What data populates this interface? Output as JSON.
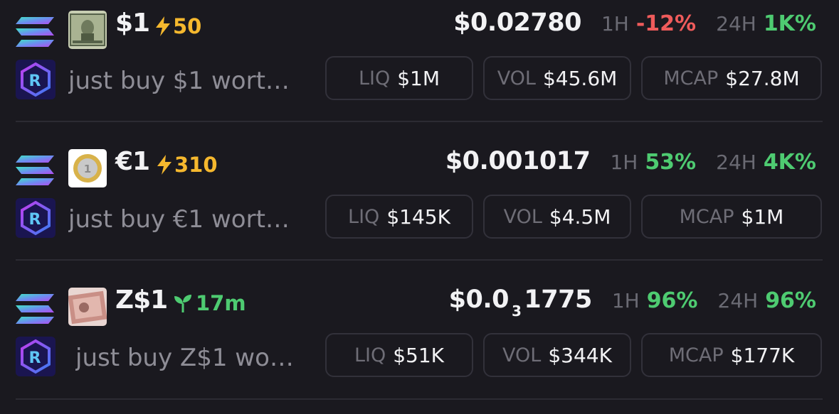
{
  "colors": {
    "background": "#1a191f",
    "negative": "#ef5b5b",
    "positive": "#4ecb71",
    "boost": "#f5b82e",
    "muted": "#6a6a73"
  },
  "icons": {
    "chain": "solana-icon",
    "dex": "raydium-icon",
    "boost": "lightning-icon",
    "age": "sprout-icon"
  },
  "tokens": [
    {
      "symbol": "$1",
      "badge_type": "boost",
      "badge": "50",
      "description": "just buy $1 wort…",
      "price_main": "$0.02780",
      "price_sub": "",
      "price_tail": "",
      "tf_1h": "1H",
      "change_1h": "-12%",
      "change_1h_dir": "neg",
      "tf_24h": "24H",
      "change_24h": "1K%",
      "change_24h_dir": "pos",
      "liq_label": "LIQ",
      "liq": "$1M",
      "vol_label": "VOL",
      "vol": "$45.6M",
      "mcap_label": "MCAP",
      "mcap": "$27.8M"
    },
    {
      "symbol": "€1",
      "badge_type": "boost",
      "badge": "310",
      "description": "just buy €1 wort…",
      "price_main": "$0.001017",
      "price_sub": "",
      "price_tail": "",
      "tf_1h": "1H",
      "change_1h": "53%",
      "change_1h_dir": "pos",
      "tf_24h": "24H",
      "change_24h": "4K%",
      "change_24h_dir": "pos",
      "liq_label": "LIQ",
      "liq": "$145K",
      "vol_label": "VOL",
      "vol": "$4.5M",
      "mcap_label": "MCAP",
      "mcap": "$1M"
    },
    {
      "symbol": "Z$1",
      "badge_type": "age",
      "badge": "17m",
      "description": "just buy Z$1 wo…",
      "price_main": "$0.0",
      "price_sub": "3",
      "price_tail": "1775",
      "tf_1h": "1H",
      "change_1h": "96%",
      "change_1h_dir": "pos",
      "tf_24h": "24H",
      "change_24h": "96%",
      "change_24h_dir": "pos",
      "liq_label": "LIQ",
      "liq": "$51K",
      "vol_label": "VOL",
      "vol": "$344K",
      "mcap_label": "MCAP",
      "mcap": "$177K"
    }
  ]
}
